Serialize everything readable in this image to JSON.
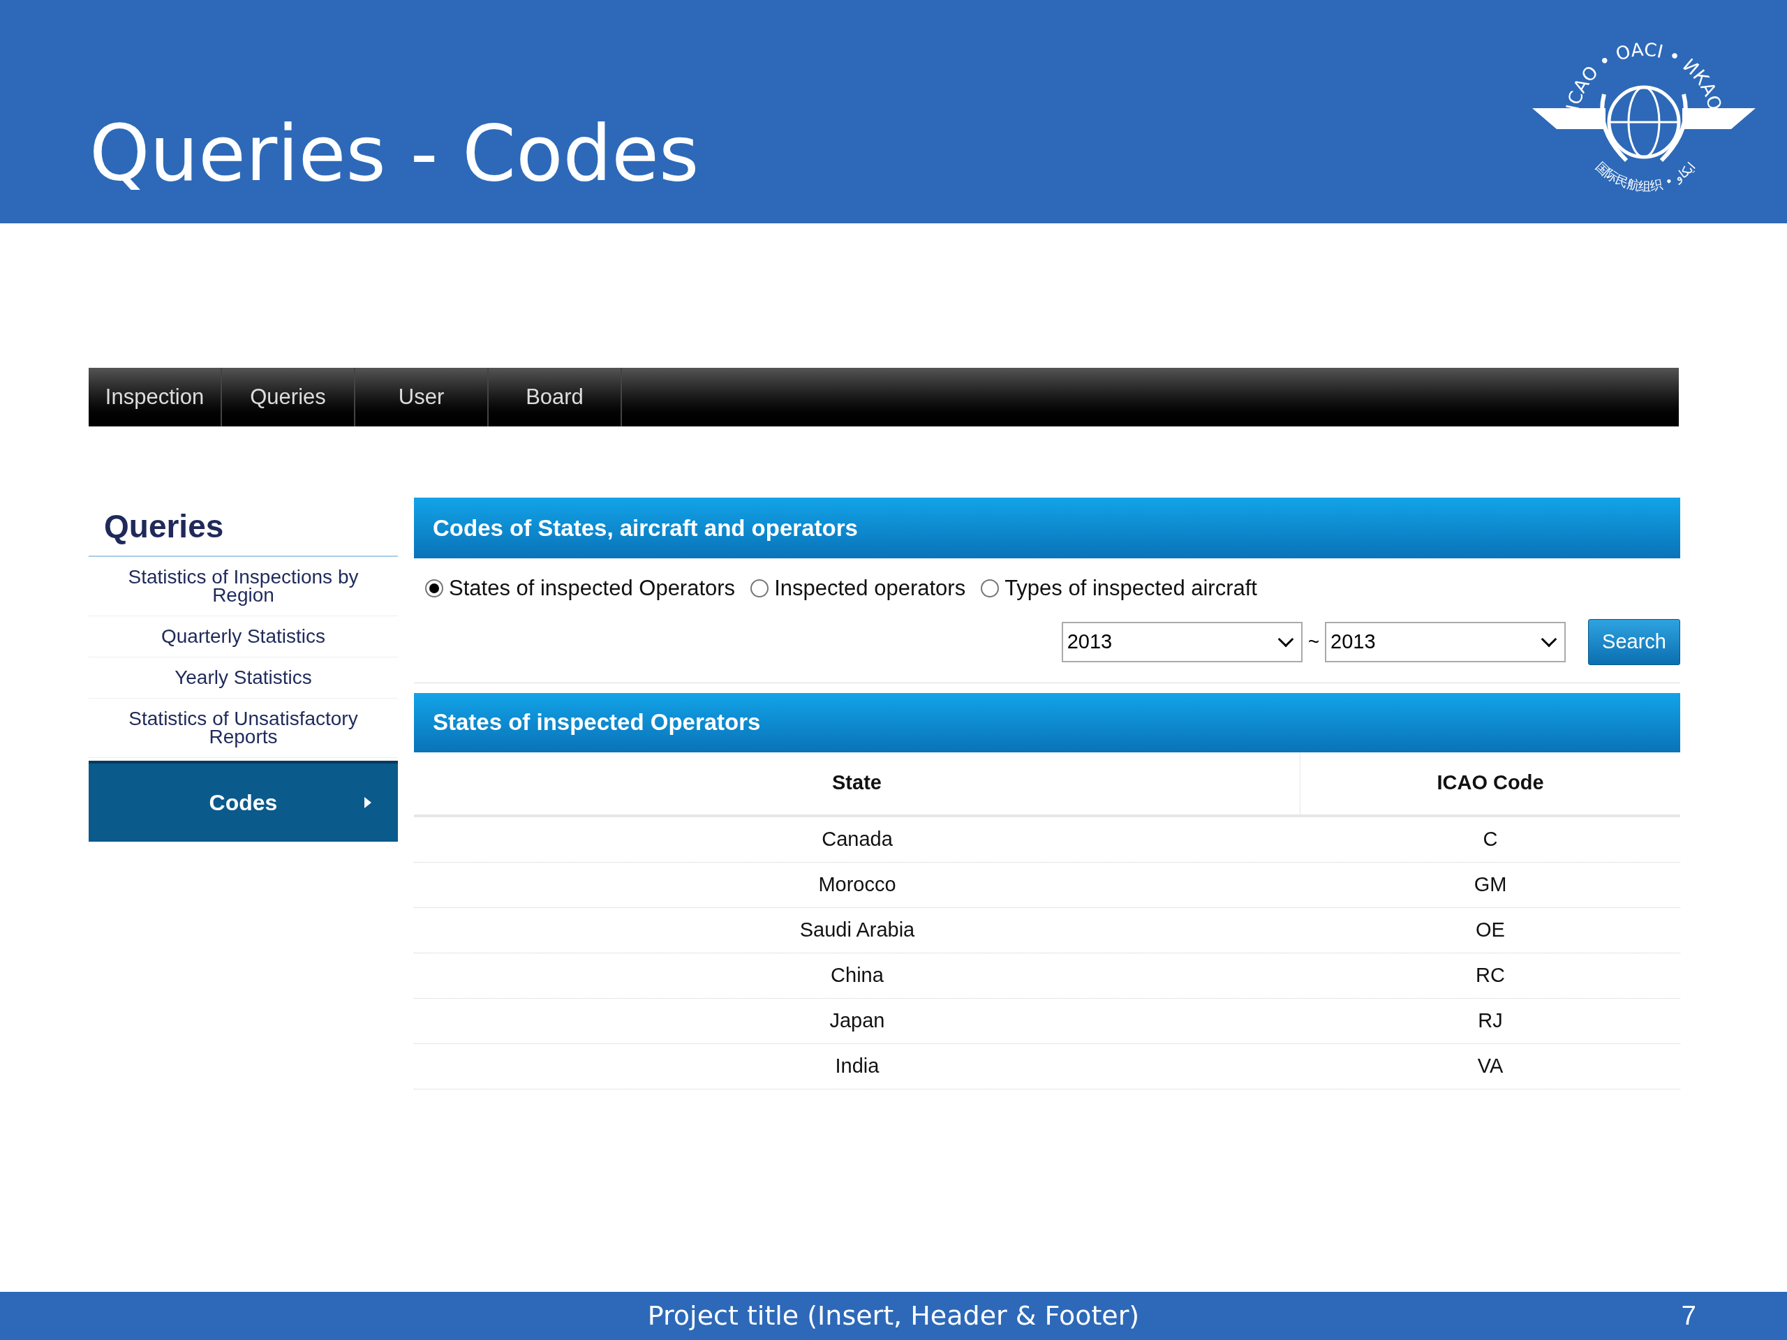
{
  "slide": {
    "title": "Queries - Codes",
    "logo": {
      "top_text": "ICAO • OACI • ИКАО",
      "bottom_text": "国际民航组织 • ايكاو"
    }
  },
  "nav": {
    "tabs": [
      {
        "label": "Inspection",
        "selected": false
      },
      {
        "label": "Queries",
        "selected": false
      },
      {
        "label": "User",
        "selected": false
      },
      {
        "label": "Board",
        "selected": false
      }
    ]
  },
  "sidebar": {
    "title": "Queries",
    "items": [
      {
        "label": "Statistics of Inspections by Region",
        "selected": false
      },
      {
        "label": "Quarterly Statistics",
        "selected": false
      },
      {
        "label": "Yearly Statistics",
        "selected": false
      },
      {
        "label": "Statistics of Unsatisfactory Reports",
        "selected": false
      },
      {
        "label": "Codes",
        "selected": true
      }
    ]
  },
  "panel": {
    "title": "Codes of States, aircraft and operators",
    "options": [
      {
        "label": "States of inspected Operators",
        "selected": true
      },
      {
        "label": "Inspected operators",
        "selected": false
      },
      {
        "label": "Types of inspected aircraft",
        "selected": false
      }
    ],
    "from": "2013",
    "separator": "~",
    "to": "2013",
    "search_button": "Search"
  },
  "results": {
    "title": "States of inspected Operators",
    "columns": [
      "State",
      "ICAO Code"
    ],
    "rows": [
      [
        "Canada",
        "C"
      ],
      [
        "Morocco",
        "GM"
      ],
      [
        "Saudi Arabia",
        "OE"
      ],
      [
        "China",
        "RC"
      ],
      [
        "Japan",
        "RJ"
      ],
      [
        "India",
        "VA"
      ]
    ]
  },
  "footer": {
    "text": "Project title (Insert, Header & Footer)",
    "page": "7"
  }
}
